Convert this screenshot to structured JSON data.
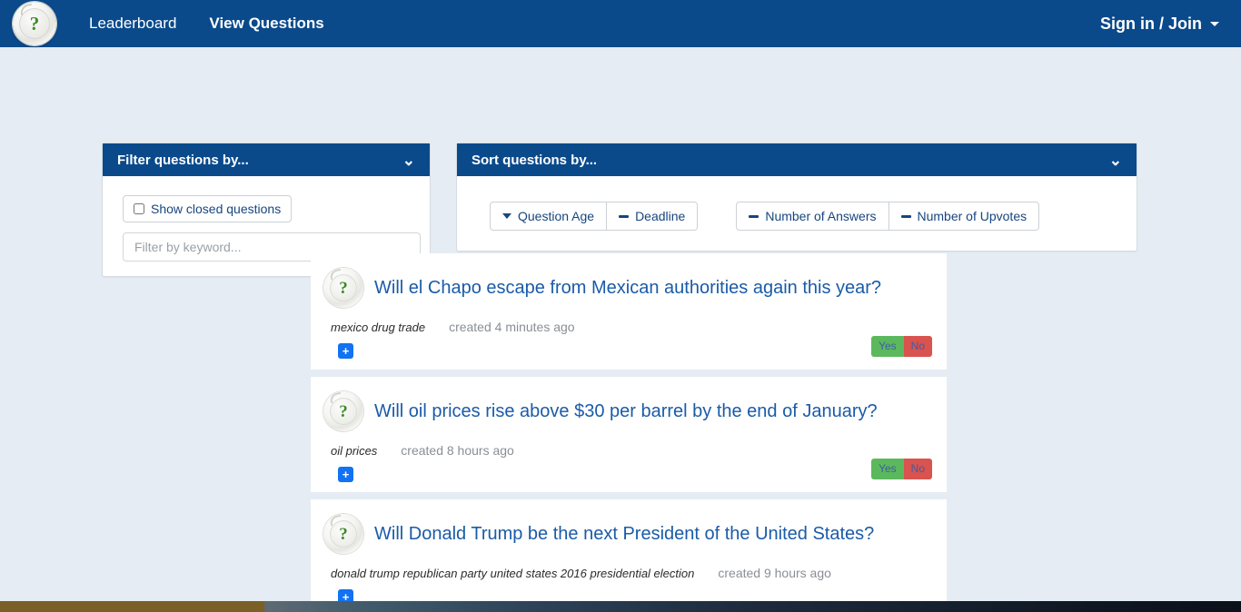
{
  "navbar": {
    "logo_icon": "question-mark-badge-icon",
    "logo_glyph": "?",
    "links": [
      {
        "label": "Leaderboard",
        "active": false
      },
      {
        "label": "View Questions",
        "active": true
      }
    ],
    "signin_label": "Sign in / Join",
    "caret_icon": "caret-down-icon",
    "background_color": "#0a4a8b"
  },
  "filter_panel": {
    "title": "Filter questions by...",
    "collapse_icon": "chevron-down-icon",
    "collapse_glyph": "⌄",
    "show_closed_label": "Show closed questions",
    "show_closed_checked": false,
    "keyword_placeholder": "Filter by keyword...",
    "keyword_value": ""
  },
  "sort_panel": {
    "title": "Sort questions by...",
    "collapse_icon": "chevron-down-icon",
    "collapse_glyph": "⌄",
    "groups": [
      {
        "buttons": [
          {
            "label": "Question Age",
            "icon": "chevron-down-icon",
            "state": "descending"
          },
          {
            "label": "Deadline",
            "icon": "dash-icon",
            "state": "unsorted"
          }
        ]
      },
      {
        "buttons": [
          {
            "label": "Number of Answers",
            "icon": "dash-icon",
            "state": "unsorted"
          },
          {
            "label": "Number of Upvotes",
            "icon": "dash-icon",
            "state": "unsorted"
          }
        ]
      }
    ]
  },
  "questions": [
    {
      "avatar_icon": "question-mark-badge-icon",
      "avatar_glyph": "?",
      "title": "Will el Chapo escape from Mexican authorities again this year?",
      "tags": "mexico drug trade",
      "created": "created 4 minutes ago",
      "add_answer_glyph": "+",
      "answers": [
        {
          "label": "Yes",
          "color": "#5cb85c"
        },
        {
          "label": "No",
          "color": "#d9534f"
        }
      ]
    },
    {
      "avatar_icon": "question-mark-badge-icon",
      "avatar_glyph": "?",
      "title": "Will oil prices rise above $30 per barrel by the end of January?",
      "tags": "oil prices",
      "created": "created 8 hours ago",
      "add_answer_glyph": "+",
      "answers": [
        {
          "label": "Yes",
          "color": "#5cb85c"
        },
        {
          "label": "No",
          "color": "#d9534f"
        }
      ]
    },
    {
      "avatar_icon": "question-mark-badge-icon",
      "avatar_glyph": "?",
      "title": "Will Donald Trump be the next President of the United States?",
      "tags": "donald trump republican party united states 2016 presidential election",
      "created": "created 9 hours ago",
      "add_answer_glyph": "+",
      "answers": []
    }
  ],
  "theme": {
    "page_background": "#e6ecf3",
    "primary_blue": "#0a4a8b",
    "link_blue": "#1a5ba8",
    "accent_blue": "#1172f3",
    "green": "#5cb85c",
    "red": "#d9534f",
    "logo_green": "#3d8b27"
  }
}
